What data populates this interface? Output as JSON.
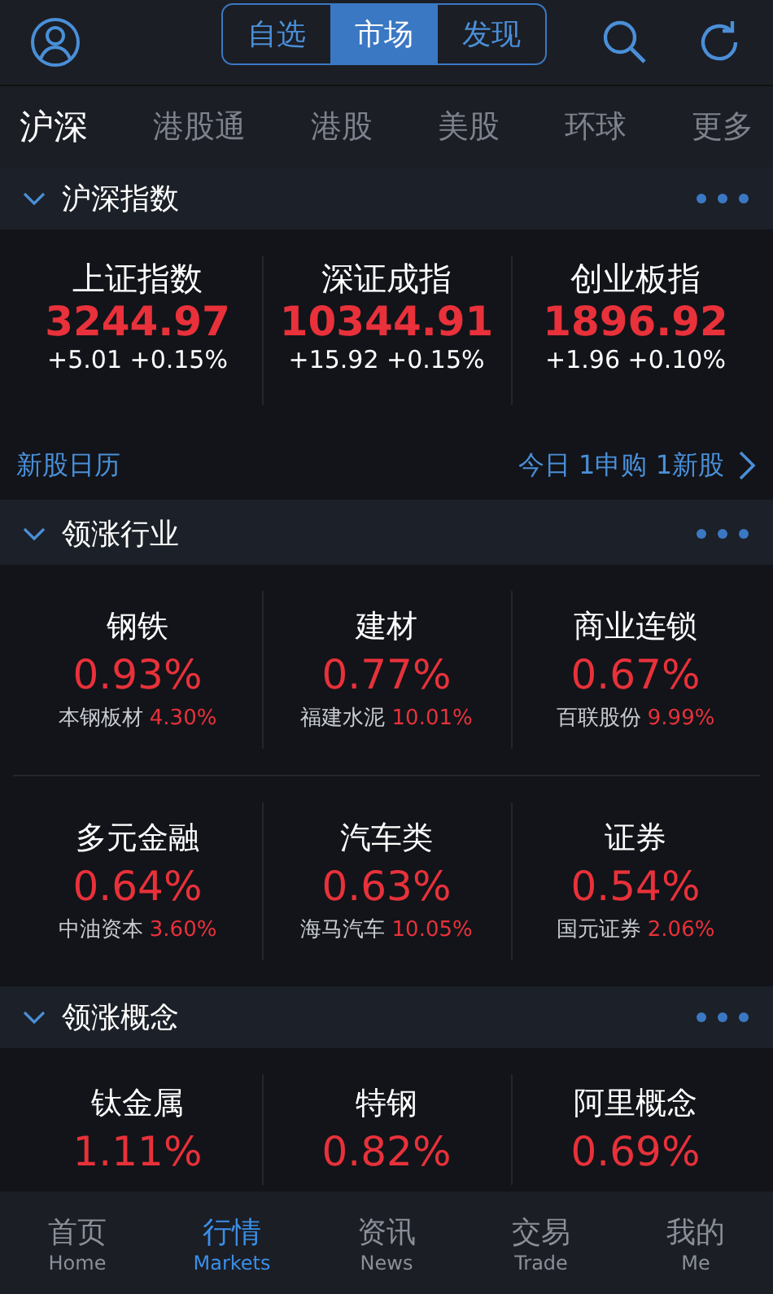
{
  "header": {
    "segments": [
      {
        "label": "自选",
        "selected": false
      },
      {
        "label": "市场",
        "selected": true
      },
      {
        "label": "发现",
        "selected": false
      }
    ]
  },
  "market_tabs": [
    {
      "label": "沪深",
      "selected": true
    },
    {
      "label": "港股通",
      "selected": false
    },
    {
      "label": "港股",
      "selected": false
    },
    {
      "label": "美股",
      "selected": false
    },
    {
      "label": "环球",
      "selected": false
    },
    {
      "label": "更多",
      "selected": false
    }
  ],
  "index_section": {
    "title": "沪深指数",
    "expanded": true,
    "items": [
      {
        "name": "上证指数",
        "value": "3244.97",
        "change": "+5.01 +0.15%"
      },
      {
        "name": "深证成指",
        "value": "10344.91",
        "change": "+15.92 +0.15%"
      },
      {
        "name": "创业板指",
        "value": "1896.92",
        "change": "+1.96 +0.10%"
      }
    ]
  },
  "new_stock_row": {
    "title": "新股日历",
    "summary": "今日 1申购 1新股"
  },
  "industry_section": {
    "title": "领涨行业",
    "expanded": true,
    "items": [
      {
        "name": "钢铁",
        "change": "0.93%",
        "leader": "本钢板材",
        "leader_change": "4.30%"
      },
      {
        "name": "建材",
        "change": "0.77%",
        "leader": "福建水泥",
        "leader_change": "10.01%"
      },
      {
        "name": "商业连锁",
        "change": "0.67%",
        "leader": "百联股份",
        "leader_change": "9.99%"
      },
      {
        "name": "多元金融",
        "change": "0.64%",
        "leader": "中油资本",
        "leader_change": "3.60%"
      },
      {
        "name": "汽车类",
        "change": "0.63%",
        "leader": "海马汽车",
        "leader_change": "10.05%"
      },
      {
        "name": "证券",
        "change": "0.54%",
        "leader": "国元证券",
        "leader_change": "2.06%"
      }
    ]
  },
  "concept_section": {
    "title": "领涨概念",
    "expanded": true,
    "items": [
      {
        "name": "钛金属",
        "change": "1.11%"
      },
      {
        "name": "特钢",
        "change": "0.82%"
      },
      {
        "name": "阿里概念",
        "change": "0.69%"
      }
    ]
  },
  "bottom_nav": [
    {
      "label": "首页",
      "sublabel": "Home",
      "selected": false
    },
    {
      "label": "行情",
      "sublabel": "Markets",
      "selected": true
    },
    {
      "label": "资讯",
      "sublabel": "News",
      "selected": false
    },
    {
      "label": "交易",
      "sublabel": "Trade",
      "selected": false
    },
    {
      "label": "我的",
      "sublabel": "Me",
      "selected": false
    }
  ]
}
